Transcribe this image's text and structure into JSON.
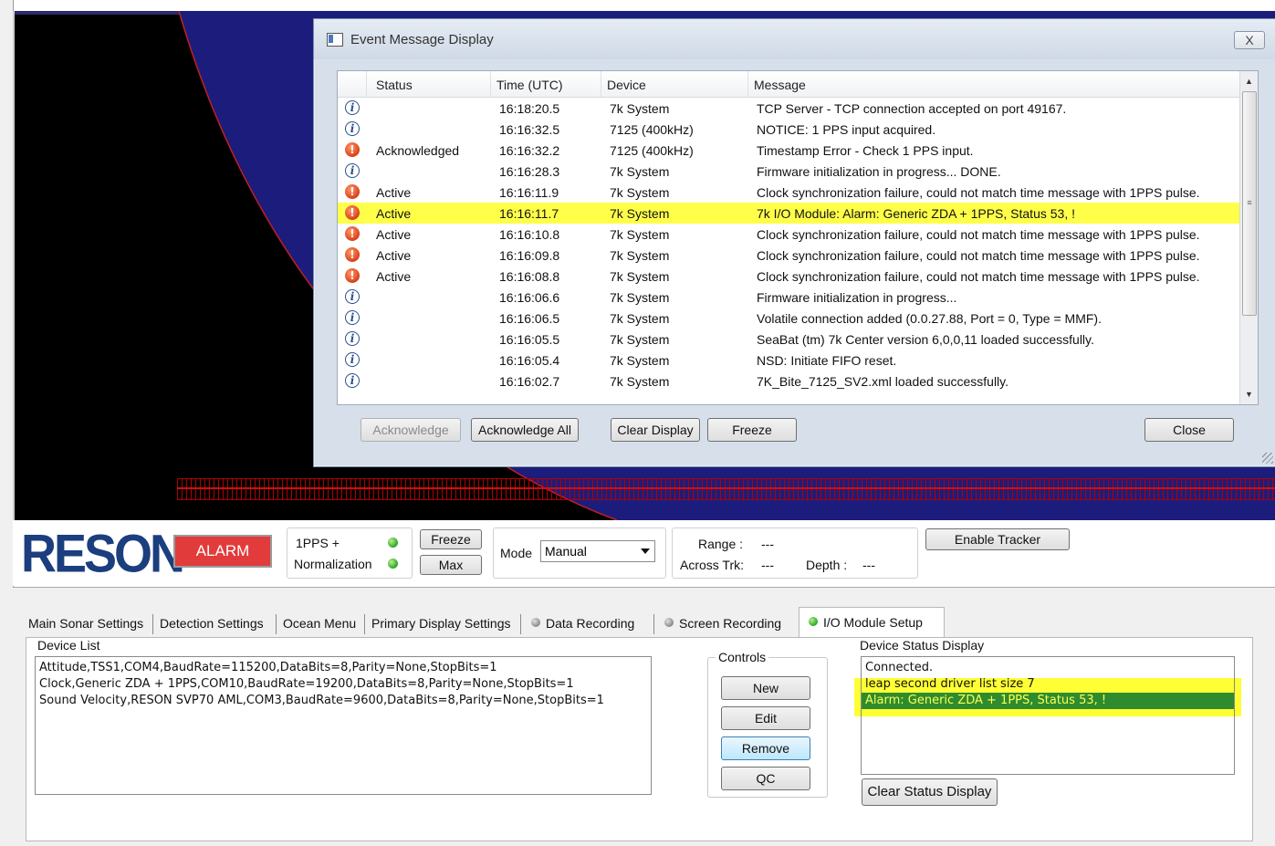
{
  "dialog": {
    "title": "Event Message Display",
    "close_x": "X",
    "columns": [
      "Status",
      "Time (UTC)",
      "Device",
      "Message"
    ],
    "rows": [
      {
        "icon": "info-icon",
        "status": "",
        "time": "16:18:20.5",
        "device": "7k System",
        "message": "TCP Server - TCP connection accepted on port 49167."
      },
      {
        "icon": "info-icon",
        "status": "",
        "time": "16:16:32.5",
        "device": "7125 (400kHz)",
        "message": "NOTICE:  1 PPS input acquired."
      },
      {
        "icon": "warning-icon",
        "status": "Acknowledged",
        "time": "16:16:32.2",
        "device": "7125 (400kHz)",
        "message": "Timestamp Error - Check 1 PPS input."
      },
      {
        "icon": "info-icon",
        "status": "",
        "time": "16:16:28.3",
        "device": "7k System",
        "message": "Firmware initialization in progress...  DONE."
      },
      {
        "icon": "warning-icon",
        "status": "Active",
        "time": "16:16:11.9",
        "device": "7k System",
        "message": "Clock synchronization failure, could not match time message with 1PPS pulse."
      },
      {
        "icon": "warning-icon",
        "status": "Active",
        "time": "16:16:11.7",
        "device": "7k System",
        "message": "7k I/O Module: Alarm: Generic ZDA + 1PPS, Status 53, !"
      },
      {
        "icon": "warning-icon",
        "status": "Active",
        "time": "16:16:10.8",
        "device": "7k System",
        "message": "Clock synchronization failure, could not match time message with 1PPS pulse."
      },
      {
        "icon": "warning-icon",
        "status": "Active",
        "time": "16:16:09.8",
        "device": "7k System",
        "message": "Clock synchronization failure, could not match time message with 1PPS pulse."
      },
      {
        "icon": "warning-icon",
        "status": "Active",
        "time": "16:16:08.8",
        "device": "7k System",
        "message": "Clock synchronization failure, could not match time message with 1PPS pulse."
      },
      {
        "icon": "info-icon",
        "status": "",
        "time": "16:16:06.6",
        "device": "7k System",
        "message": "Firmware initialization in progress..."
      },
      {
        "icon": "info-icon",
        "status": "",
        "time": "16:16:06.5",
        "device": "7k System",
        "message": "Volatile connection added (0.0.27.88, Port = 0, Type = MMF)."
      },
      {
        "icon": "info-icon",
        "status": "",
        "time": "16:16:05.5",
        "device": "7k System",
        "message": "SeaBat (tm) 7k Center version 6,0,0,11 loaded successfully."
      },
      {
        "icon": "info-icon",
        "status": "",
        "time": "16:16:05.4",
        "device": "7k System",
        "message": "NSD: Initiate FIFO reset."
      },
      {
        "icon": "info-icon",
        "status": "",
        "time": "16:16:02.7",
        "device": "7k System",
        "message": "7K_Bite_7125_SV2.xml loaded successfully."
      }
    ],
    "buttons": {
      "acknowledge": "Acknowledge",
      "acknowledge_all": "Acknowledge All",
      "clear_display": "Clear Display",
      "freeze": "Freeze",
      "close": "Close"
    }
  },
  "toolbar": {
    "logo": "RESON",
    "alarm": "ALARM",
    "pps_label": "1PPS +",
    "normalization_label": "Normalization",
    "freeze": "Freeze",
    "max": "Max",
    "mode_label": "Mode",
    "mode_value": "Manual",
    "range_label": "Range :",
    "range_value": "---",
    "across_label": "Across Trk:",
    "across_value": "---",
    "depth_label": "Depth :",
    "depth_value": "---",
    "enable_tracker": "Enable Tracker"
  },
  "tabs": [
    {
      "label": "Main Sonar Settings"
    },
    {
      "label": "Detection Settings"
    },
    {
      "label": "Ocean Menu"
    },
    {
      "label": "Primary Display Settings"
    },
    {
      "label": "Data Recording"
    },
    {
      "label": "Screen Recording"
    },
    {
      "label": "I/O Module Setup"
    }
  ],
  "io_module": {
    "device_list_label": "Device List",
    "devices": [
      "Attitude,TSS1,COM4,BaudRate=115200,DataBits=8,Parity=None,StopBits=1",
      "Clock,Generic ZDA + 1PPS,COM10,BaudRate=19200,DataBits=8,Parity=None,StopBits=1",
      "Sound Velocity,RESON SVP70 AML,COM3,BaudRate=9600,DataBits=8,Parity=None,StopBits=1"
    ],
    "controls_label": "Controls",
    "new": "New",
    "edit": "Edit",
    "remove": "Remove",
    "qc": "QC",
    "status_label": "Device Status Display",
    "status_lines": [
      "Connected.",
      "leap second driver list size 7",
      "Alarm: Generic ZDA + 1PPS, Status 53, !"
    ],
    "clear_status": "Clear Status Display"
  },
  "colors": {
    "highlight": "#ffff4a",
    "alarm_red": "#e23b3b",
    "status_green": "#2e8b2e",
    "logo_blue": "#1b3e7e",
    "arc_blue": "#1c1c7c"
  }
}
